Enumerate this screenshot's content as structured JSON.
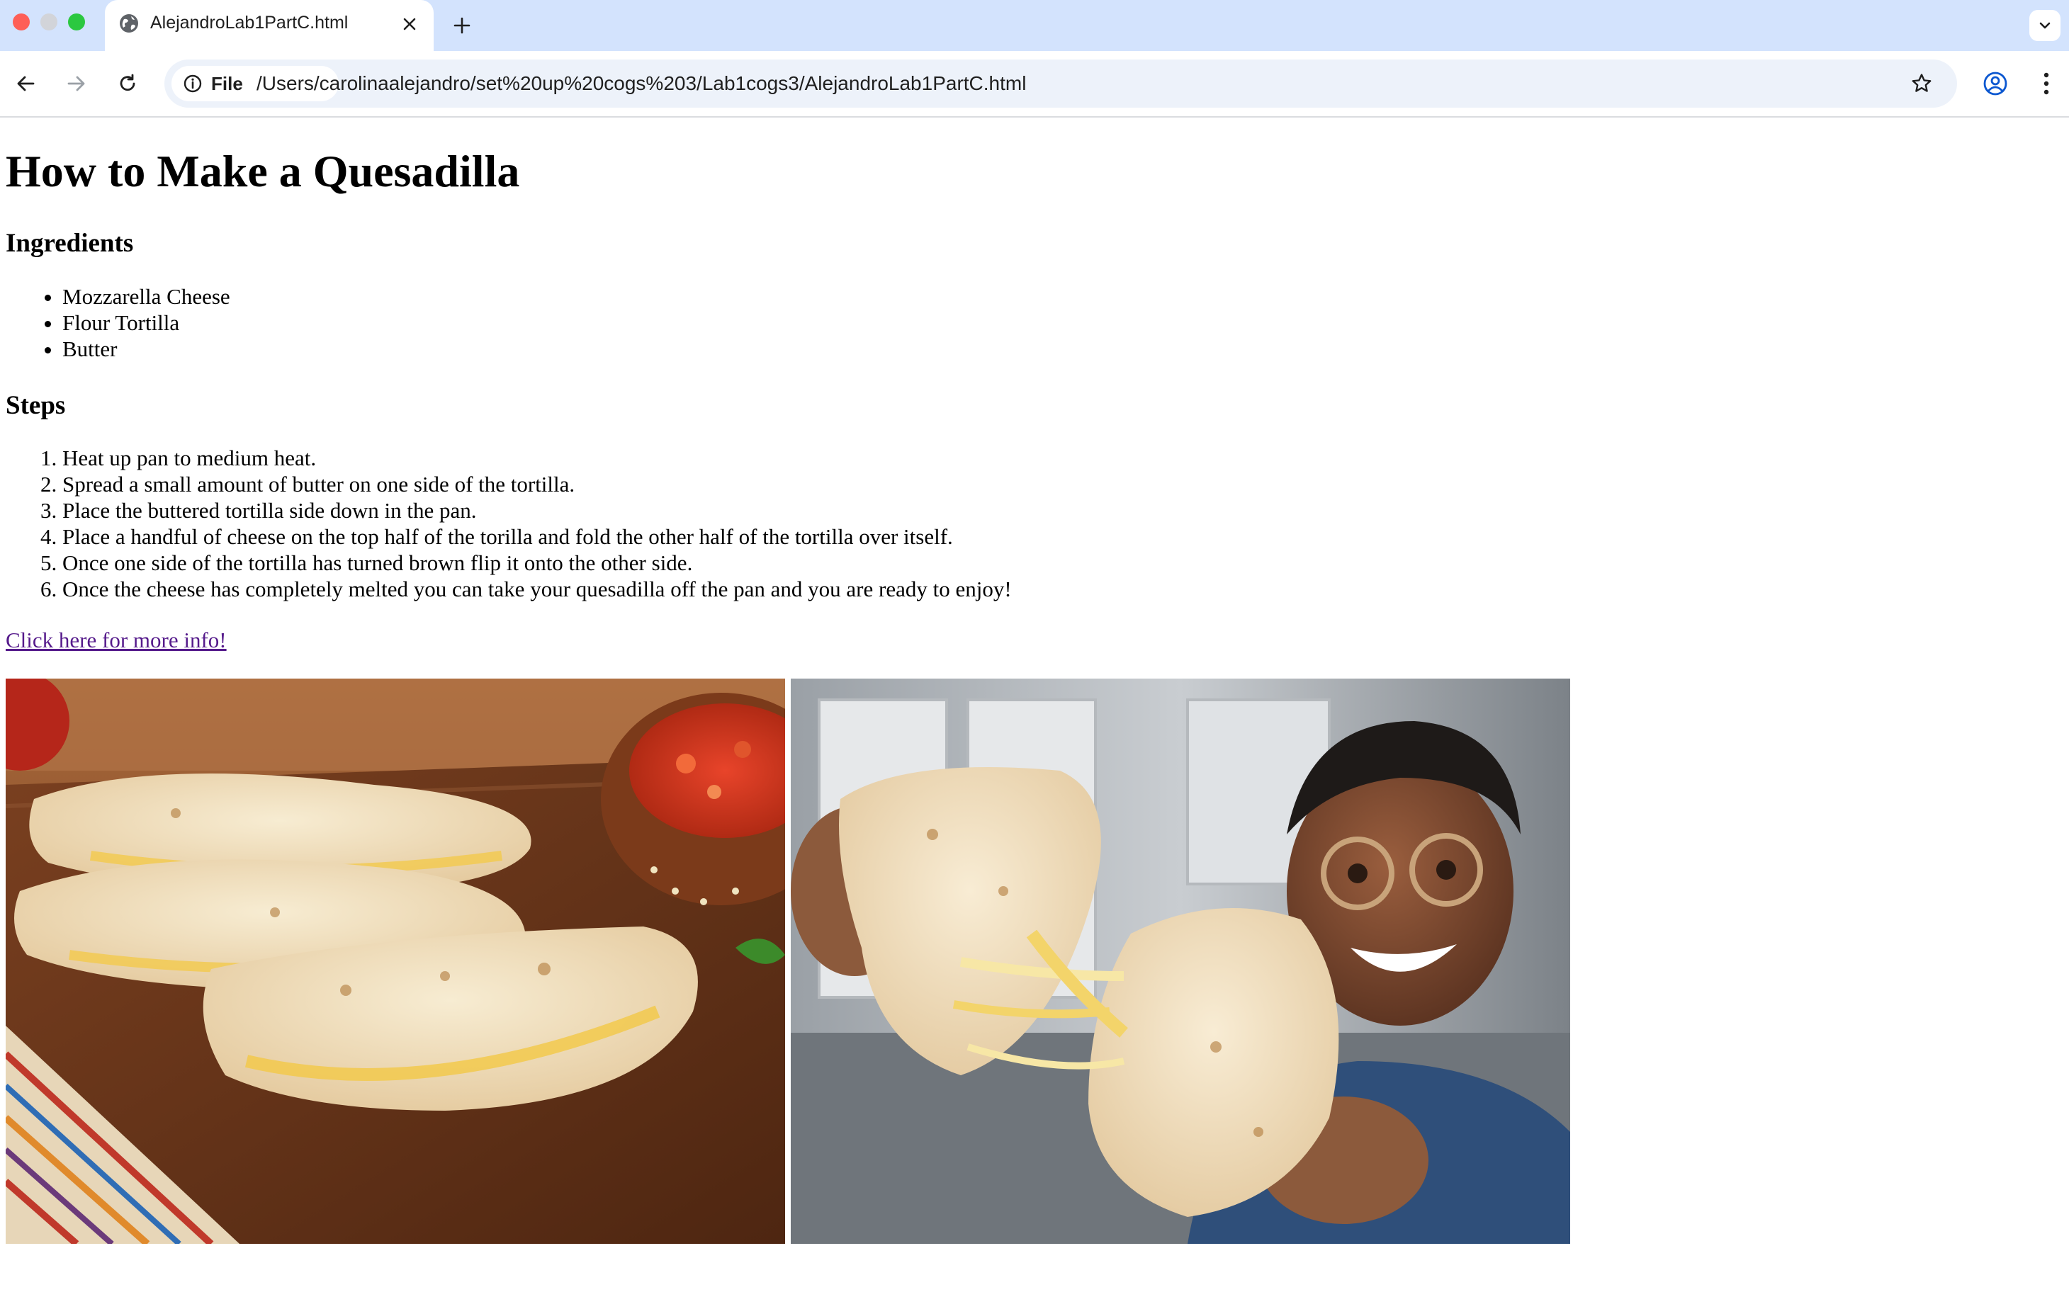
{
  "browser": {
    "tab_title": "AlejandroLab1PartC.html",
    "chip_label": "File",
    "url": "/Users/carolinaalejandro/set%20up%20cogs%203/Lab1cogs3/AlejandroLab1PartC.html"
  },
  "page": {
    "title": "How to Make a Quesadilla",
    "ingredients_heading": "Ingredients",
    "ingredients": [
      "Mozzarella Cheese",
      "Flour Tortilla",
      "Butter"
    ],
    "steps_heading": "Steps",
    "steps": [
      "Heat up pan to medium heat.",
      "Spread a small amount of butter on one side of the tortilla.",
      "Place the buttered tortilla side down in the pan.",
      "Place a handful of cheese on the top half of the torilla and fold the other half of the tortilla over itself.",
      "Once one side of the tortilla has turned brown flip it onto the other side.",
      "Once the cheese has completely melted you can take your quesadilla off the pan and you are ready to enjoy!"
    ],
    "link_text": "Click here for more info!"
  },
  "colors": {
    "tabbar": "#d3e3fd",
    "link_visited": "#551a8b",
    "omnibox": "#edf2fa"
  }
}
